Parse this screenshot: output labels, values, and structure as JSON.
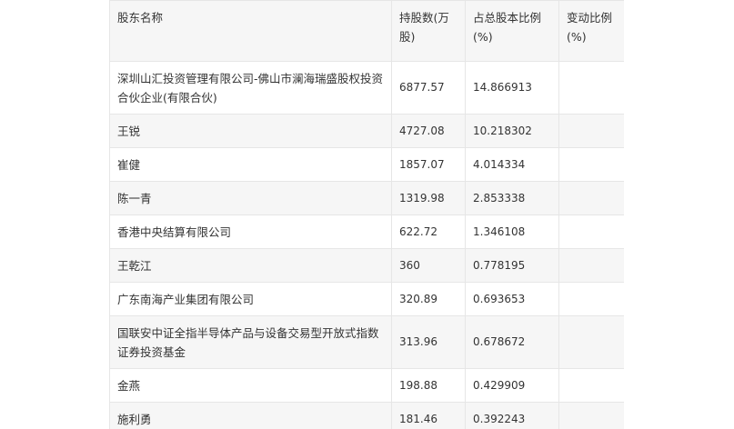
{
  "table": {
    "headers": [
      "股东名称",
      "持股数(万股)",
      "占总股本比例(%)",
      "变动比例(%)"
    ],
    "rows": [
      {
        "name": "深圳山汇投资管理有限公司-佛山市澜海瑞盛股权投资合伙企业(有限合伙)",
        "shares": "6877.57",
        "ratio": "14.866913",
        "change": ""
      },
      {
        "name": "王锐",
        "shares": "4727.08",
        "ratio": "10.218302",
        "change": ""
      },
      {
        "name": "崔健",
        "shares": "1857.07",
        "ratio": "4.014334",
        "change": ""
      },
      {
        "name": "陈一青",
        "shares": "1319.98",
        "ratio": "2.853338",
        "change": ""
      },
      {
        "name": "香港中央结算有限公司",
        "shares": "622.72",
        "ratio": "1.346108",
        "change": ""
      },
      {
        "name": "王乾江",
        "shares": "360",
        "ratio": "0.778195",
        "change": ""
      },
      {
        "name": "广东南海产业集团有限公司",
        "shares": "320.89",
        "ratio": "0.693653",
        "change": ""
      },
      {
        "name": "国联安中证全指半导体产品与设备交易型开放式指数证券投资基金",
        "shares": "313.96",
        "ratio": "0.678672",
        "change": ""
      },
      {
        "name": "金燕",
        "shares": "198.88",
        "ratio": "0.429909",
        "change": ""
      },
      {
        "name": "施利勇",
        "shares": "181.46",
        "ratio": "0.392243",
        "change": ""
      }
    ]
  }
}
